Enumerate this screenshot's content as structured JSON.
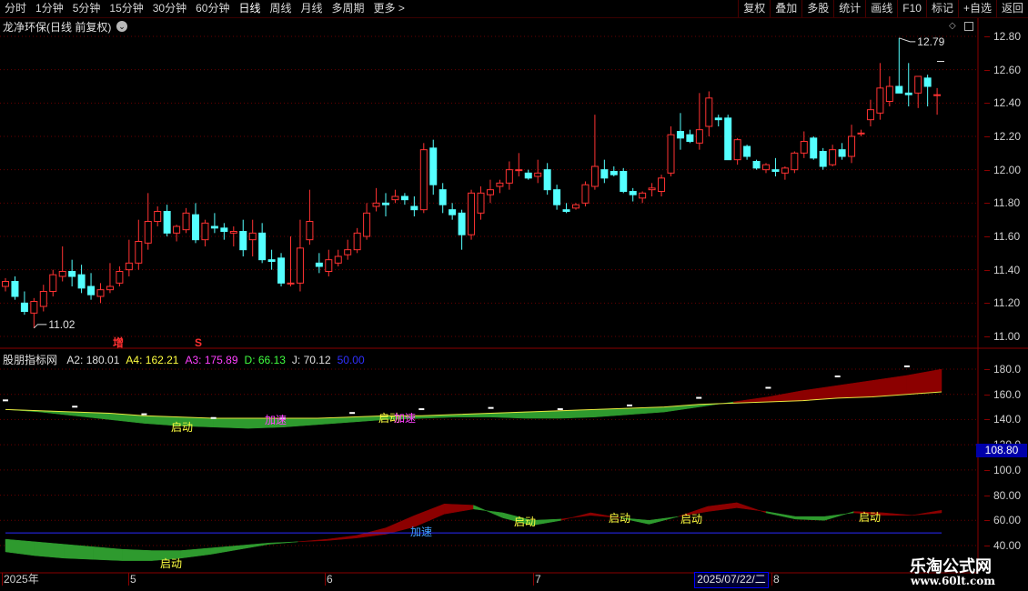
{
  "toolbar": {
    "periods": [
      "分时",
      "1分钟",
      "5分钟",
      "15分钟",
      "30分钟",
      "60分钟",
      "日线",
      "周线",
      "月线",
      "多周期",
      "更多 >"
    ],
    "active_period": "日线",
    "actions": [
      "复权",
      "叠加",
      "多股",
      "统计",
      "画线",
      "F10",
      "标记",
      "+自选",
      "返回"
    ]
  },
  "stock": {
    "title": "龙净环保(日线 前复权)"
  },
  "price_chart": {
    "y_ticks": [
      "12.80",
      "12.60",
      "12.40",
      "12.20",
      "12.00",
      "11.80",
      "11.60",
      "11.40",
      "11.20",
      "11.00"
    ],
    "ylim": [
      10.98,
      12.86
    ],
    "high_label": "12.79",
    "low_label": "11.02",
    "markers": [
      {
        "text": "增",
        "color": "#ff3030"
      },
      {
        "text": "S",
        "color": "#ff3030"
      }
    ]
  },
  "indicator": {
    "name": "股朋指标网",
    "values": [
      {
        "label": "A2: 180.01",
        "color": "#e0e0e0"
      },
      {
        "label": "A4: 162.21",
        "color": "#ffff40"
      },
      {
        "label": "A3: 175.89",
        "color": "#ff40ff"
      },
      {
        "label": "D: 66.13",
        "color": "#40ff40"
      },
      {
        "label": "J: 70.12",
        "color": "#e0e0e0"
      },
      {
        "label": "50.00",
        "color": "#3030ff"
      }
    ],
    "y_ticks": [
      "180.0",
      "160.0",
      "140.0",
      "120.0",
      "100.0",
      "80.00",
      "60.00",
      "40.00"
    ],
    "ylim": [
      33,
      188
    ],
    "price_flag": "108.80",
    "labels": [
      {
        "text": "启动",
        "color": "#ffff40"
      },
      {
        "text": "加速",
        "color": "#ff40ff"
      },
      {
        "text": "启动",
        "color": "#ffff40"
      },
      {
        "text": "加速",
        "color": "#ff40ff"
      },
      {
        "text": "加速",
        "color": "#40a0ff"
      },
      {
        "text": "启动",
        "color": "#ffff40"
      },
      {
        "text": "启动",
        "color": "#ffff40"
      },
      {
        "text": "启动",
        "color": "#ffff40"
      },
      {
        "text": "启动",
        "color": "#ffff40"
      },
      {
        "text": "启动",
        "color": "#ffff40"
      }
    ]
  },
  "date_axis": {
    "labels": [
      "2025年",
      "5",
      "6",
      "7",
      "8"
    ],
    "highlight": "2025/07/22/二"
  },
  "watermark": {
    "title": "乐淘公式网",
    "url": "www.60lt.com"
  },
  "chart_data": {
    "type": "candlestick",
    "ohlc": [
      [
        11.3,
        11.35,
        11.27,
        11.33
      ],
      [
        11.33,
        11.36,
        11.22,
        11.24
      ],
      [
        11.2,
        11.27,
        11.13,
        11.15
      ],
      [
        11.14,
        11.23,
        11.05,
        11.21
      ],
      [
        11.18,
        11.31,
        11.15,
        11.27
      ],
      [
        11.27,
        11.4,
        11.24,
        11.37
      ],
      [
        11.36,
        11.54,
        11.33,
        11.39
      ],
      [
        11.39,
        11.46,
        11.3,
        11.36
      ],
      [
        11.37,
        11.43,
        11.26,
        11.29
      ],
      [
        11.3,
        11.38,
        11.22,
        11.25
      ],
      [
        11.24,
        11.32,
        11.2,
        11.28
      ],
      [
        11.28,
        11.44,
        11.26,
        11.3
      ],
      [
        11.32,
        11.42,
        11.3,
        11.39
      ],
      [
        11.4,
        11.58,
        11.36,
        11.44
      ],
      [
        11.44,
        11.7,
        11.4,
        11.57
      ],
      [
        11.56,
        11.86,
        11.52,
        11.69
      ],
      [
        11.69,
        11.78,
        11.66,
        11.75
      ],
      [
        11.75,
        11.79,
        11.6,
        11.62
      ],
      [
        11.62,
        11.67,
        11.57,
        11.66
      ],
      [
        11.64,
        11.77,
        11.62,
        11.74
      ],
      [
        11.73,
        11.8,
        11.56,
        11.58
      ],
      [
        11.58,
        11.7,
        11.54,
        11.68
      ],
      [
        11.66,
        11.74,
        11.62,
        11.65
      ],
      [
        11.65,
        11.68,
        11.58,
        11.63
      ],
      [
        11.62,
        11.66,
        11.54,
        11.63
      ],
      [
        11.63,
        11.7,
        11.48,
        11.52
      ],
      [
        11.58,
        11.7,
        11.48,
        11.62
      ],
      [
        11.62,
        11.68,
        11.44,
        11.46
      ],
      [
        11.46,
        11.52,
        11.4,
        11.45
      ],
      [
        11.47,
        11.5,
        11.3,
        11.32
      ],
      [
        11.32,
        11.6,
        11.3,
        11.32
      ],
      [
        11.32,
        11.7,
        11.27,
        11.53
      ],
      [
        11.58,
        11.88,
        11.55,
        11.69
      ],
      [
        11.44,
        11.5,
        11.38,
        11.42
      ],
      [
        11.39,
        11.52,
        11.36,
        11.46
      ],
      [
        11.44,
        11.52,
        11.42,
        11.48
      ],
      [
        11.49,
        11.58,
        11.46,
        11.52
      ],
      [
        11.52,
        11.65,
        11.5,
        11.62
      ],
      [
        11.6,
        11.8,
        11.58,
        11.74
      ],
      [
        11.78,
        11.89,
        11.75,
        11.8
      ],
      [
        11.8,
        11.86,
        11.72,
        11.79
      ],
      [
        11.82,
        11.88,
        11.8,
        11.84
      ],
      [
        11.84,
        11.86,
        11.79,
        11.82
      ],
      [
        11.78,
        11.84,
        11.72,
        11.76
      ],
      [
        11.76,
        12.16,
        11.74,
        12.12
      ],
      [
        12.13,
        12.18,
        11.85,
        11.91
      ],
      [
        11.88,
        11.92,
        11.74,
        11.79
      ],
      [
        11.76,
        11.8,
        11.7,
        11.73
      ],
      [
        11.74,
        11.76,
        11.52,
        11.61
      ],
      [
        11.61,
        11.88,
        11.58,
        11.86
      ],
      [
        11.74,
        11.9,
        11.7,
        11.86
      ],
      [
        11.85,
        11.94,
        11.8,
        11.88
      ],
      [
        11.9,
        11.94,
        11.86,
        11.92
      ],
      [
        11.92,
        12.05,
        11.88,
        12.0
      ],
      [
        12.0,
        12.1,
        11.96,
        12.0
      ],
      [
        11.98,
        12.0,
        11.94,
        11.95
      ],
      [
        11.96,
        12.06,
        11.92,
        11.98
      ],
      [
        12.0,
        12.04,
        11.85,
        11.88
      ],
      [
        11.88,
        11.91,
        11.76,
        11.79
      ],
      [
        11.76,
        11.8,
        11.74,
        11.75
      ],
      [
        11.77,
        11.8,
        11.76,
        11.79
      ],
      [
        11.8,
        11.93,
        11.78,
        11.91
      ],
      [
        11.9,
        12.33,
        11.88,
        12.02
      ],
      [
        12.0,
        12.06,
        11.92,
        11.95
      ],
      [
        11.99,
        12.02,
        11.96,
        11.97
      ],
      [
        11.99,
        12.01,
        11.86,
        11.87
      ],
      [
        11.87,
        11.89,
        11.81,
        11.85
      ],
      [
        11.83,
        11.87,
        11.8,
        11.86
      ],
      [
        11.88,
        11.92,
        11.84,
        11.89
      ],
      [
        11.87,
        11.97,
        11.84,
        11.95
      ],
      [
        11.98,
        12.26,
        11.96,
        12.21
      ],
      [
        12.23,
        12.34,
        12.12,
        12.19
      ],
      [
        12.21,
        12.24,
        12.16,
        12.17
      ],
      [
        12.16,
        12.46,
        12.12,
        12.24
      ],
      [
        12.26,
        12.47,
        12.2,
        12.43
      ],
      [
        12.31,
        12.33,
        12.26,
        12.3
      ],
      [
        12.31,
        12.33,
        12.06,
        12.06
      ],
      [
        12.06,
        12.19,
        12.03,
        12.18
      ],
      [
        12.14,
        12.15,
        12.06,
        12.08
      ],
      [
        12.05,
        12.06,
        12.0,
        12.01
      ],
      [
        12.0,
        12.04,
        11.98,
        12.03
      ],
      [
        12.0,
        12.07,
        11.96,
        11.99
      ],
      [
        11.98,
        12.02,
        11.94,
        12.01
      ],
      [
        12.0,
        12.11,
        11.98,
        12.1
      ],
      [
        12.1,
        12.23,
        12.07,
        12.17
      ],
      [
        12.19,
        12.2,
        12.06,
        12.07
      ],
      [
        12.11,
        12.13,
        12.0,
        12.02
      ],
      [
        12.03,
        12.15,
        12.02,
        12.12
      ],
      [
        12.12,
        12.16,
        12.06,
        12.08
      ],
      [
        12.08,
        12.27,
        12.04,
        12.2
      ],
      [
        12.22,
        12.24,
        12.2,
        12.22
      ],
      [
        12.3,
        12.42,
        12.26,
        12.36
      ],
      [
        12.34,
        12.64,
        12.3,
        12.49
      ],
      [
        12.41,
        12.56,
        12.38,
        12.5
      ],
      [
        12.5,
        12.79,
        12.46,
        12.46
      ],
      [
        12.46,
        12.64,
        12.38,
        12.45
      ],
      [
        12.46,
        12.55,
        12.37,
        12.56
      ],
      [
        12.55,
        12.57,
        12.38,
        12.5
      ],
      [
        12.45,
        12.49,
        12.33,
        12.45
      ]
    ],
    "series": [
      {
        "name": "A2",
        "values": [
          148,
          146,
          143,
          140,
          137,
          135,
          134,
          133,
          134,
          136,
          138,
          140,
          141,
          142,
          142,
          141,
          141,
          142,
          144,
          146,
          150,
          154,
          158,
          163,
          167,
          171,
          175,
          180
        ]
      },
      {
        "name": "A4",
        "values": [
          148,
          147,
          146,
          145,
          143,
          142,
          141,
          141,
          141,
          141,
          142,
          143,
          143,
          144,
          145,
          146,
          147,
          148,
          149,
          150,
          152,
          153,
          154,
          155,
          157,
          158,
          160,
          162
        ]
      },
      {
        "name": "D",
        "values": [
          45,
          43,
          41,
          39,
          37,
          36,
          36,
          38,
          40,
          42,
          43,
          44,
          46,
          49,
          55,
          65,
          69,
          66,
          60,
          61,
          64,
          62,
          60,
          63,
          67,
          70,
          67,
          63,
          63,
          66,
          64,
          64,
          66
        ]
      },
      {
        "name": "J",
        "values": [
          35,
          32,
          30,
          29,
          28,
          28,
          30,
          33,
          37,
          41,
          43,
          45,
          48,
          54,
          64,
          73,
          72,
          62,
          56,
          60,
          66,
          62,
          57,
          63,
          71,
          74,
          66,
          61,
          60,
          67,
          66,
          64,
          68
        ]
      }
    ]
  }
}
